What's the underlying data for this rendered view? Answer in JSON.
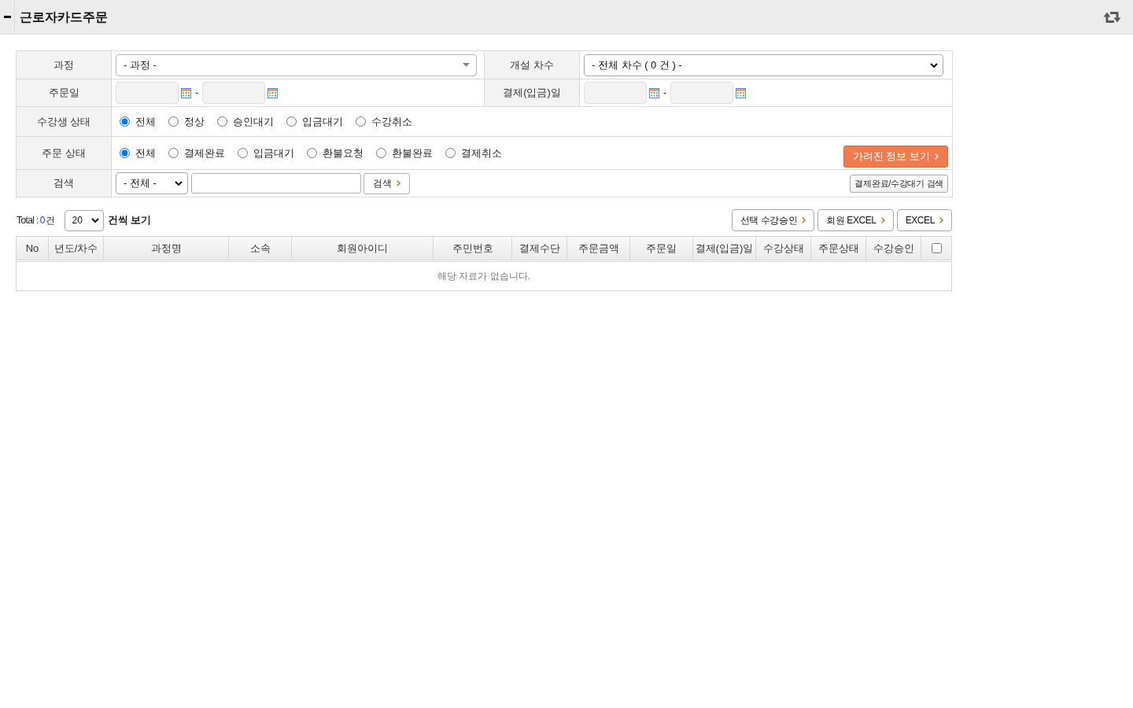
{
  "header": {
    "title": "근로자카드주문"
  },
  "filters": {
    "course": {
      "label": "과정",
      "value": "- 과정 -"
    },
    "session": {
      "label": "개설 차수",
      "value": "- 전체 차수 ( 0 건 ) -"
    },
    "order_date": {
      "label": "주문일",
      "separator": "-"
    },
    "payment_date": {
      "label": "결제(입금)일",
      "separator": "-"
    },
    "student_status": {
      "label": "수강생 상태",
      "options": [
        {
          "label": "전체",
          "selected": true
        },
        {
          "label": "정상",
          "selected": false
        },
        {
          "label": "승인대기",
          "selected": false
        },
        {
          "label": "입금대기",
          "selected": false
        },
        {
          "label": "수강취소",
          "selected": false
        }
      ]
    },
    "order_status": {
      "label": "주문 상태",
      "options": [
        {
          "label": "전체",
          "selected": true
        },
        {
          "label": "결제완료",
          "selected": false
        },
        {
          "label": "입금대기",
          "selected": false
        },
        {
          "label": "환불요청",
          "selected": false
        },
        {
          "label": "환불완료",
          "selected": false
        },
        {
          "label": "결제취소",
          "selected": false
        }
      ]
    },
    "hidden_info_button": "가려진 정보 보기",
    "search": {
      "label": "검색",
      "scope": "- 전체 -",
      "button": "검색"
    },
    "paid_waiting_button": "결제완료/수강대기 검색"
  },
  "list": {
    "total_label": "Total :",
    "total_count": "0",
    "total_unit": "건",
    "page_size": "20",
    "page_size_suffix": "건씩 보기",
    "buttons": [
      "선택 수강승인",
      "회원 EXCEL",
      "EXCEL"
    ]
  },
  "table": {
    "columns": [
      "No",
      "년도/차수",
      "과정명",
      "소속",
      "회원아이디",
      "주민번호",
      "결제수단",
      "주문금액",
      "주문일",
      "결제(입금)일",
      "수강상태",
      "주문상태",
      "수강승인"
    ],
    "select_all": {
      "checked": false
    },
    "empty_message": "해당 자료가 없습니다."
  }
}
